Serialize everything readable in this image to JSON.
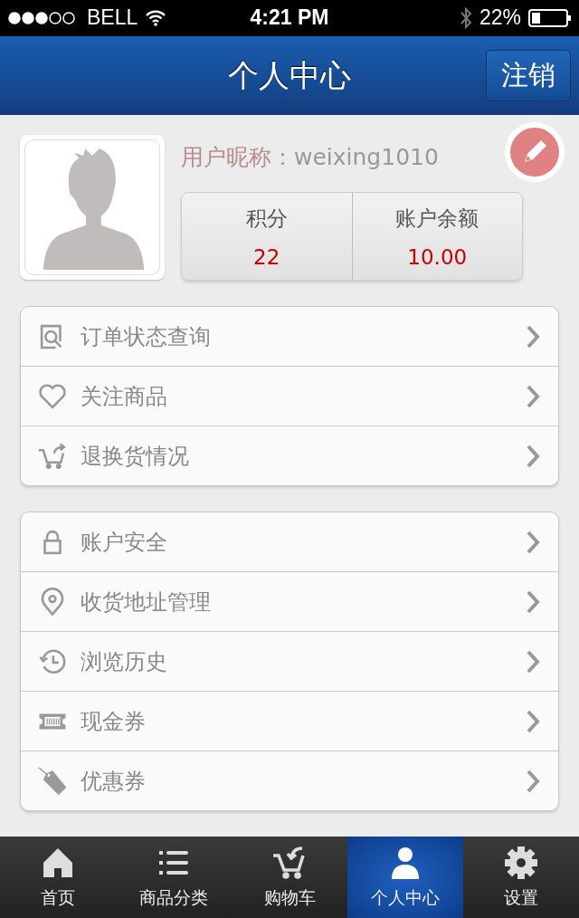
{
  "status_bar": {
    "carrier": "BELL",
    "time": "4:21 PM",
    "battery": "22%"
  },
  "header": {
    "title": "个人中心",
    "logout": "注销"
  },
  "profile": {
    "nickname_label": "用户昵称：",
    "nickname": "weixing1010",
    "stats": [
      {
        "label": "积分",
        "value": "22"
      },
      {
        "label": "账户余额",
        "value": "10.00"
      }
    ]
  },
  "menu_groups": [
    [
      {
        "kind": "order",
        "label": "订单状态查询"
      },
      {
        "kind": "heart",
        "label": "关注商品"
      },
      {
        "kind": "return",
        "label": "退换货情况"
      }
    ],
    [
      {
        "kind": "lock",
        "label": "账户安全"
      },
      {
        "kind": "pin",
        "label": "收货地址管理"
      },
      {
        "kind": "history",
        "label": "浏览历史"
      },
      {
        "kind": "ticket",
        "label": "现金券"
      },
      {
        "kind": "tag",
        "label": "优惠券"
      }
    ]
  ],
  "tab_bar": [
    {
      "kind": "home",
      "label": "首页",
      "selected": false
    },
    {
      "kind": "list",
      "label": "商品分类",
      "selected": false
    },
    {
      "kind": "cart",
      "label": "购物车",
      "selected": false
    },
    {
      "kind": "user",
      "label": "个人中心",
      "selected": true
    },
    {
      "kind": "gear",
      "label": "设置",
      "selected": false
    }
  ]
}
